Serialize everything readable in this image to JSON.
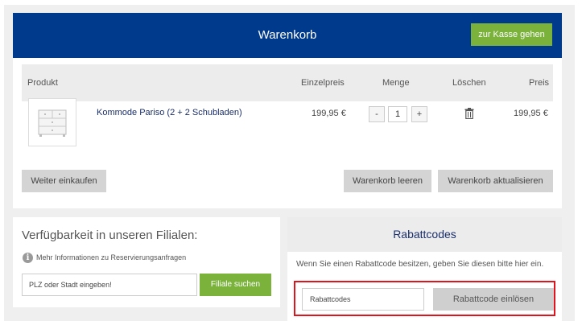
{
  "cart": {
    "title": "Warenkorb",
    "checkout_label": "zur Kasse gehen",
    "columns": {
      "product": "Produkt",
      "unit_price": "Einzelpreis",
      "quantity": "Menge",
      "delete": "Löschen",
      "price": "Preis"
    },
    "items": [
      {
        "name": "Kommode Pariso (2 + 2 Schubladen)",
        "unit_price": "199,95 €",
        "quantity": "1",
        "minus": "-",
        "plus": "+",
        "price": "199,95 €",
        "delete_icon": "trash-icon"
      }
    ],
    "continue_label": "Weiter einkaufen",
    "empty_label": "Warenkorb leeren",
    "update_label": "Warenkorb aktualisieren"
  },
  "availability": {
    "title": "Verfügbarkeit in unseren Filialen:",
    "info_text": "Mehr Informationen zu Reservierungsanfragen",
    "info_icon": "info-icon",
    "input_placeholder": "PLZ oder Stadt eingeben!",
    "button_label": "Filiale suchen"
  },
  "discount": {
    "title": "Rabattcodes",
    "description": "Wenn Sie einen Rabattcode besitzen, geben Sie diesen bitte hier ein.",
    "input_placeholder": "Rabattcodes",
    "button_label": "Rabattcode einlösen"
  },
  "colors": {
    "header_blue": "#003a8c",
    "accent_green": "#7ab23c",
    "highlight_red": "#e0141c"
  }
}
